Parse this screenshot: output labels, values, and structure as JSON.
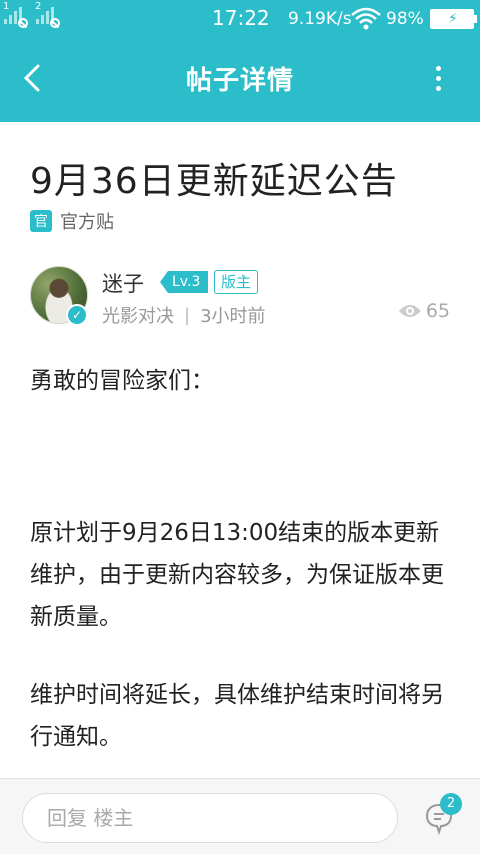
{
  "status_bar": {
    "sim1_label": "1",
    "sim2_label": "2",
    "time": "17:22",
    "net_speed": "9.19K/s",
    "battery_percent": "98%",
    "icons": [
      "signal-icon",
      "wifi-icon",
      "battery-charging-icon"
    ]
  },
  "header": {
    "title": "帖子详情",
    "back_icon": "back-arrow-icon",
    "more_icon": "more-vertical-icon"
  },
  "post": {
    "title": "9月36日更新延迟公告",
    "official_badge": "官",
    "official_label": "官方贴",
    "author": {
      "name": "迷子",
      "level": "Lv.3",
      "role": "版主",
      "game": "光影对决",
      "separator": "|",
      "time_ago": "3小时前",
      "views": "65"
    },
    "paragraphs": [
      "勇敢的冒险家们：",
      "原计划于9月26日13:00结束的版本更新维护，由于更新内容较多，为保证版本更新质量。",
      "维护时间将延长，具体维护结束时间将另行通知。"
    ]
  },
  "bottom": {
    "reply_placeholder": "回复  楼主",
    "comment_count": "2"
  },
  "colors": {
    "accent": "#2bbdc9",
    "text": "#222222",
    "muted": "#999999"
  }
}
